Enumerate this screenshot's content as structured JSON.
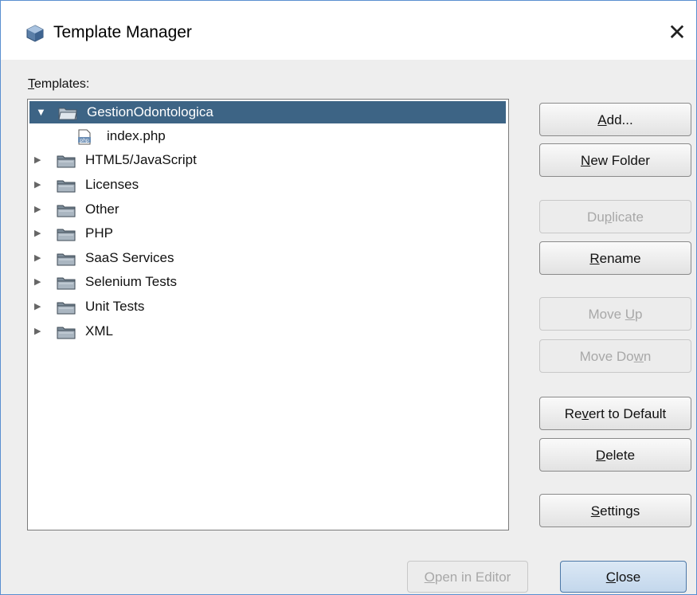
{
  "window": {
    "title": "Template Manager",
    "close_glyph": "✕",
    "app_icon": "cube-icon"
  },
  "tree": {
    "label_mnemonic": "T",
    "label_rest": "emplates:",
    "items": [
      {
        "label": "GestionOdontologica",
        "expanded": true,
        "selected": true,
        "type": "folder"
      },
      {
        "label": "index.php",
        "type": "file",
        "icon": "php-file-icon"
      },
      {
        "label": "HTML5/JavaScript",
        "type": "folder"
      },
      {
        "label": "Licenses",
        "type": "folder"
      },
      {
        "label": "Other",
        "type": "folder"
      },
      {
        "label": "PHP",
        "type": "folder"
      },
      {
        "label": "SaaS Services",
        "type": "folder"
      },
      {
        "label": "Selenium Tests",
        "type": "folder"
      },
      {
        "label": "Unit Tests",
        "type": "folder"
      },
      {
        "label": "XML",
        "type": "folder"
      }
    ],
    "expanded_glyph": "▼",
    "collapsed_glyph": "▶"
  },
  "buttons": {
    "add": {
      "pre": "",
      "mn": "A",
      "post": "dd...",
      "enabled": true
    },
    "new_folder": {
      "pre": "",
      "mn": "N",
      "post": "ew Folder",
      "enabled": true
    },
    "duplicate": {
      "pre": "Du",
      "mn": "p",
      "post": "licate",
      "enabled": false
    },
    "rename": {
      "pre": "",
      "mn": "R",
      "post": "ename",
      "enabled": true
    },
    "move_up": {
      "pre": "Move ",
      "mn": "U",
      "post": "p",
      "enabled": false
    },
    "move_down": {
      "pre": "Move Do",
      "mn": "w",
      "post": "n",
      "enabled": false
    },
    "revert": {
      "pre": "Re",
      "mn": "v",
      "post": "ert to Default",
      "enabled": true
    },
    "delete": {
      "pre": "",
      "mn": "D",
      "post": "elete",
      "enabled": true
    },
    "settings": {
      "pre": "",
      "mn": "S",
      "post": "ettings",
      "enabled": true
    },
    "open_in_editor": {
      "pre": "",
      "mn": "O",
      "post": "pen in Editor",
      "enabled": false
    },
    "close": {
      "pre": "",
      "mn": "C",
      "post": "lose",
      "enabled": true
    }
  },
  "colors": {
    "selection": "#3d6485",
    "window_border": "#5a8fd0"
  }
}
